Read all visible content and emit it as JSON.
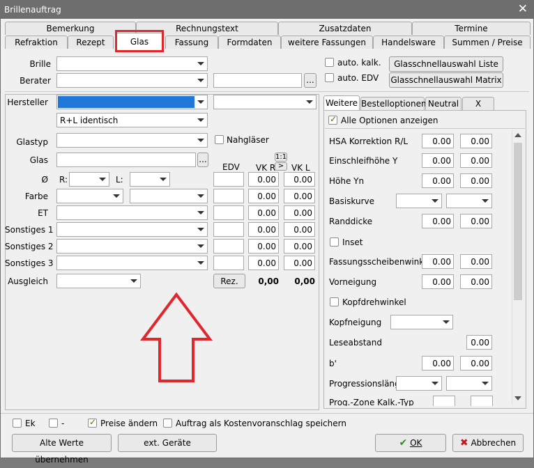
{
  "window": {
    "title": "Brillenauftrag",
    "close": "✕"
  },
  "tabs_row1": [
    "Bemerkung",
    "Rechnungstext",
    "Zusatzdaten",
    "Termine"
  ],
  "tabs_row2": [
    "Refraktion",
    "Rezept",
    "Glas",
    "Fassung",
    "Formdaten",
    "weitere Fassungen",
    "Handelsware",
    "Summen / Preise"
  ],
  "top": {
    "brille_label": "Brille",
    "berater_label": "Berater",
    "auto_kalk": "auto. kalk.",
    "auto_edv": "auto. EDV",
    "ellipsis": "...",
    "btn_liste": "Glasschnellauswahl Liste",
    "btn_matrix": "Glasschnellauswahl Matrix"
  },
  "left": {
    "hersteller_label": "Hersteller",
    "rl_value": "R+L identisch",
    "glastyp_label": "Glastyp",
    "nahglaeser": "Nahgläser",
    "glas_label": "Glas",
    "ellipsis": "...",
    "edv": "EDV",
    "one_one": "1:1",
    "gt": ">",
    "vkr": "VK R",
    "vkl": "VK L",
    "o_label": "Ø",
    "r_label": "R:",
    "l_label": "L:",
    "farbe_label": "Farbe",
    "et_label": "ET",
    "s1": "Sonstiges 1",
    "s2": "Sonstiges 2",
    "s3": "Sonstiges 3",
    "ausgleich": "Ausgleich",
    "rez": "Rez.",
    "zero": "0.00",
    "total_r": "0,00",
    "total_l": "0,00"
  },
  "right": {
    "tabs": [
      "Weitere",
      "Bestelloptionen",
      "Neutral",
      "X"
    ],
    "alle_optionen": "Alle Optionen anzeigen",
    "rows": {
      "hsa": "HSA Korrektion R/L",
      "einschleif": "Einschleifhöhe Y",
      "hoehe": "Höhe Yn",
      "basiskurve": "Basiskurve",
      "randdicke": "Randdicke",
      "inset": "Inset",
      "fassungsscheibenwinkel": "Fassungsscheibenwinkel",
      "vorneigung": "Vorneigung",
      "kopfdrehwinkel": "Kopfdrehwinkel",
      "kopfneigung": "Kopfneigung",
      "leseabstand": "Leseabstand",
      "b": "b'",
      "progressionslaenge": "Progressionslänge",
      "prog_zone": "Prog.-Zone Kalk.-Typ"
    },
    "zero": "0.00"
  },
  "bottom": {
    "ek": "Ek",
    "dash": "-",
    "preise_aendern": "Preise ändern",
    "kostenvoranschlag": "Auftrag als Kostenvoranschlag speichern",
    "alte_werte": "Alte Werte übernehmen",
    "ext_geraete": "ext. Geräte",
    "ok": "OK",
    "abbrechen": "Abbrechen"
  }
}
